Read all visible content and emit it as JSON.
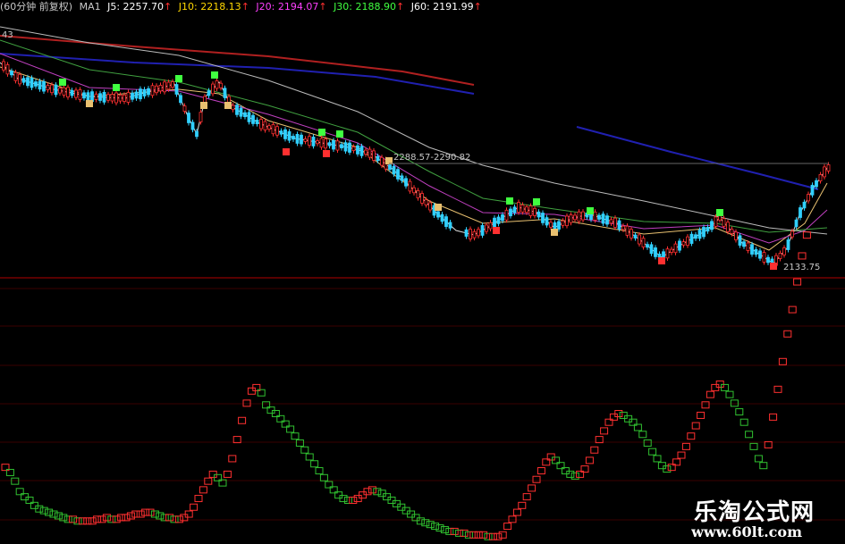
{
  "header": {
    "period": "(60分钟 前复权)",
    "indicator": "MA1",
    "j5": "J5: 2257.70",
    "j10": "J10: 2218.13",
    "j20": "J20: 2194.07",
    "j30": "J30: 2188.90",
    "j60": "J60: 2191.99",
    "arrow": "↑",
    "colors": {
      "j5": "#ffffff",
      "j10": "#ffd700",
      "j20": "#ff40ff",
      "j30": "#40ff40",
      "j60": "#ffffff",
      "arrow": "#ff3030"
    }
  },
  "price_panel": {
    "left_edge_label": "43",
    "range_label": "2288.57-2290.82",
    "low_label": "2133.75"
  },
  "watermark": {
    "name": "乐淘公式网",
    "url": "www.60lt.com"
  },
  "chart_data": [
    {
      "type": "candlestick",
      "series": [
        {
          "name": "J5",
          "color": "#dddddd"
        },
        {
          "name": "J10",
          "color": "#e8c070"
        },
        {
          "name": "J20",
          "color": "#c040c0"
        },
        {
          "name": "J30",
          "color": "#40a040"
        },
        {
          "name": "J60",
          "color": "#bbbbbb"
        }
      ],
      "long_lines": {
        "red": "#b02020",
        "blue": "#2020b0"
      },
      "annotations": [
        "2288.57-2290.82",
        "2133.75"
      ]
    },
    {
      "type": "bar",
      "bull_color": "#ff3030",
      "bear_color": "#30c030",
      "values": [
        44,
        41,
        36,
        30,
        27,
        25,
        22,
        20,
        19,
        18,
        17,
        16,
        15,
        14,
        14,
        13,
        13,
        13,
        13,
        14,
        14,
        15,
        14,
        14,
        15,
        15,
        16,
        17,
        17,
        18,
        18,
        17,
        16,
        15,
        15,
        14,
        14,
        15,
        17,
        21,
        26,
        31,
        36,
        40,
        38,
        35,
        40,
        49,
        60,
        71,
        81,
        88,
        90,
        87,
        80,
        77,
        75,
        72,
        69,
        66,
        62,
        58,
        54,
        50,
        46,
        42,
        38,
        34,
        31,
        28,
        26,
        25,
        25,
        26,
        28,
        30,
        31,
        30,
        29,
        27,
        25,
        23,
        21,
        19,
        17,
        15,
        13,
        12,
        11,
        10,
        9,
        8,
        7,
        7,
        6,
        6,
        5,
        5,
        5,
        5,
        4,
        4,
        4,
        5,
        10,
        14,
        18,
        22,
        27,
        32,
        37,
        42,
        47,
        50,
        48,
        45,
        42,
        40,
        39,
        40,
        43,
        48,
        54,
        60,
        65,
        70,
        73,
        75,
        74,
        72,
        70,
        67,
        63,
        58,
        53,
        49,
        45,
        43,
        44,
        47,
        51,
        56,
        62,
        68,
        74,
        80,
        86,
        90,
        92,
        90,
        86,
        81,
        76,
        70,
        63,
        56,
        49,
        45,
        57,
        73,
        89,
        105,
        121,
        135,
        151,
        166,
        178
      ]
    }
  ]
}
